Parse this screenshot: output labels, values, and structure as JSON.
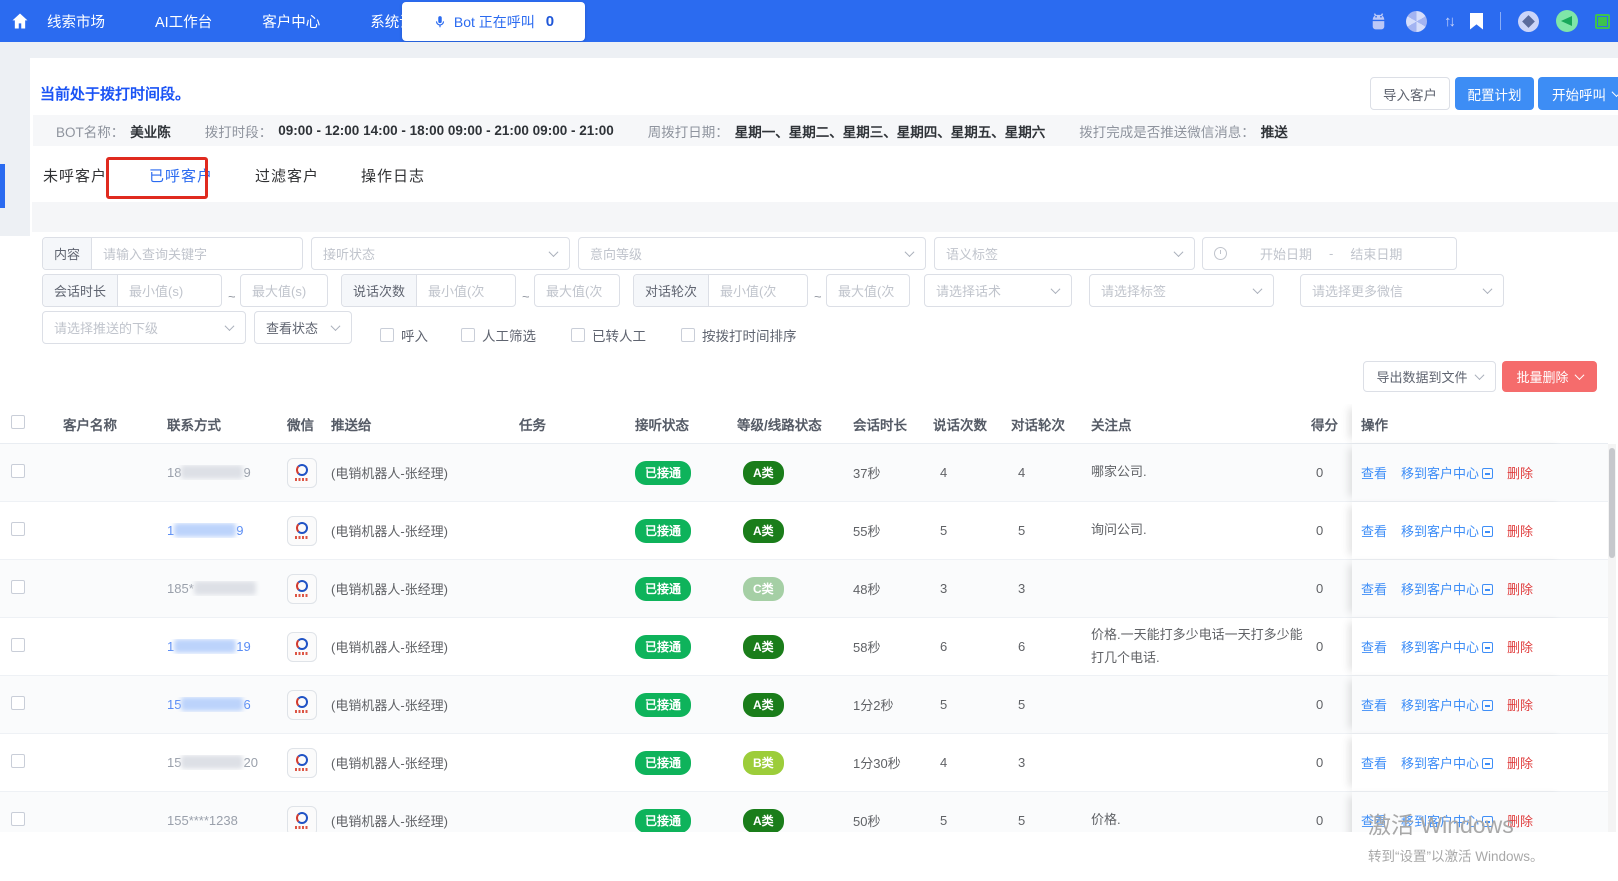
{
  "nav": {
    "items": [
      "线索市场",
      "AI工作台",
      "客户中心",
      "系统设置"
    ],
    "bot_button": {
      "label": "Bot 正在呼叫",
      "count": "0"
    },
    "right_icons": [
      "android-icon",
      "aperture-icon",
      "sort-arrows-icon",
      "bookmark-icon",
      "compass-icon",
      "megaphone-icon",
      "fullscreen-icon"
    ]
  },
  "page": {
    "status_text": "当前处于拨打时间段。",
    "buttons": {
      "import": "导入客户",
      "configure": "配置计划",
      "start_call": "开始呼叫"
    },
    "bot_info": [
      {
        "label": "BOT名称：",
        "value": "美业陈"
      },
      {
        "label": "拨打时段：",
        "value": "09:00 - 12:00 14:00 - 18:00 09:00 - 21:00 09:00 - 21:00"
      },
      {
        "label": "周拨打日期：",
        "value": "星期一、星期二、星期三、星期四、星期五、星期六"
      },
      {
        "label": "拨打完成是否推送微信消息：",
        "value": "推送"
      }
    ]
  },
  "tabs": {
    "items": [
      "未呼客户",
      "已呼客户",
      "过滤客户",
      "操作日志"
    ],
    "active_index": 1
  },
  "filters": {
    "row1": {
      "content_label": "内容",
      "content_placeholder": "请输入查询关键字",
      "listen_status": "接听状态",
      "intent_level": "意向等级",
      "semantic_tag": "语义标签",
      "date_start": "开始日期",
      "date_sep": "-",
      "date_end": "结束日期"
    },
    "row2": {
      "session_label": "会话时长",
      "min_s": "最小值(s)",
      "max_s": "最大值(s)",
      "speak_label": "说话次数",
      "min_c": "最小值(次",
      "max_c": "最大值(次",
      "rounds_label": "对话轮次",
      "tilde": "~",
      "script_placeholder": "请选择话术",
      "tag_placeholder": "请选择标签",
      "more_wechat_placeholder": "请选择更多微信"
    },
    "row3": {
      "push_sub_placeholder": "请选择推送的下级",
      "view_status": "查看状态",
      "checkboxes": [
        "呼入",
        "人工筛选",
        "已转人工",
        "按拨打时间排序"
      ]
    }
  },
  "toolbar": {
    "export_label": "导出数据到文件",
    "batch_delete_label": "批量删除"
  },
  "table": {
    "headers": [
      "客户名称",
      "联系方式",
      "微信",
      "推送给",
      "任务",
      "接听状态",
      "等级/线路状态",
      "会话时长",
      "说话次数",
      "对话轮次",
      "关注点",
      "得分"
    ],
    "action_header": "操作",
    "actions": {
      "view": "查看",
      "move": "移到客户中心",
      "delete": "删除"
    },
    "rows": [
      {
        "name": "",
        "phone_prefix": "18",
        "phone_suffix": "9",
        "phone_masked": true,
        "phone_style": "gray",
        "push_to": "(电销机器人-张经理)",
        "task": "",
        "listen_status": "已接通",
        "level": "A类",
        "level_type": "A",
        "duration": "37秒",
        "speak_count": "4",
        "dialog_rounds": "4",
        "focus": "哪家公司.",
        "score": "0"
      },
      {
        "name": "",
        "phone_prefix": "1",
        "phone_suffix": "9",
        "phone_masked": true,
        "phone_style": "blue",
        "push_to": "(电销机器人-张经理)",
        "task": "",
        "listen_status": "已接通",
        "level": "A类",
        "level_type": "A",
        "duration": "55秒",
        "speak_count": "5",
        "dialog_rounds": "5",
        "focus": "询问公司.",
        "score": "0"
      },
      {
        "name": "",
        "phone_prefix": "185*",
        "phone_suffix": "",
        "phone_masked": true,
        "phone_style": "gray",
        "push_to": "(电销机器人-张经理)",
        "task": "",
        "listen_status": "已接通",
        "level": "C类",
        "level_type": "C",
        "duration": "48秒",
        "speak_count": "3",
        "dialog_rounds": "3",
        "focus": "",
        "score": "0"
      },
      {
        "name": "",
        "phone_prefix": "1",
        "phone_suffix": "19",
        "phone_masked": true,
        "phone_style": "blue",
        "push_to": "(电销机器人-张经理)",
        "task": "",
        "listen_status": "已接通",
        "level": "A类",
        "level_type": "A",
        "duration": "58秒",
        "speak_count": "6",
        "dialog_rounds": "6",
        "focus": "价格.一天能打多少电话一天打多少能打几个电话.",
        "score": "0"
      },
      {
        "name": "",
        "phone_prefix": "15",
        "phone_suffix": "6",
        "phone_masked": true,
        "phone_style": "blue",
        "push_to": "(电销机器人-张经理)",
        "task": "",
        "listen_status": "已接通",
        "level": "A类",
        "level_type": "A",
        "duration": "1分2秒",
        "speak_count": "5",
        "dialog_rounds": "5",
        "focus": "",
        "score": "0"
      },
      {
        "name": "",
        "phone_prefix": "15",
        "phone_suffix": "20",
        "phone_masked": true,
        "phone_style": "gray",
        "push_to": "(电销机器人-张经理)",
        "task": "",
        "listen_status": "已接通",
        "level": "B类",
        "level_type": "B",
        "duration": "1分30秒",
        "speak_count": "4",
        "dialog_rounds": "3",
        "focus": "",
        "score": "0"
      },
      {
        "name": "",
        "phone_prefix": "155****1238",
        "phone_suffix": "",
        "phone_masked": false,
        "phone_style": "gray",
        "push_to": "(电销机器人-张经理)",
        "task": "",
        "listen_status": "已接通",
        "level": "A类",
        "level_type": "A",
        "duration": "50秒",
        "speak_count": "5",
        "dialog_rounds": "5",
        "focus": "价格.",
        "score": "0"
      }
    ]
  },
  "watermark": {
    "line1": "激活 Windows",
    "line2": "转到“设置”以激活 Windows。"
  },
  "colors": {
    "accent": "#2b6bf0",
    "link": "#3e8ef7",
    "danger": "#f56c6c",
    "success": "#0eb35b",
    "level_a": "#1a7d1a",
    "level_b": "#9ccd3a",
    "level_c": "#a5cfa5"
  }
}
